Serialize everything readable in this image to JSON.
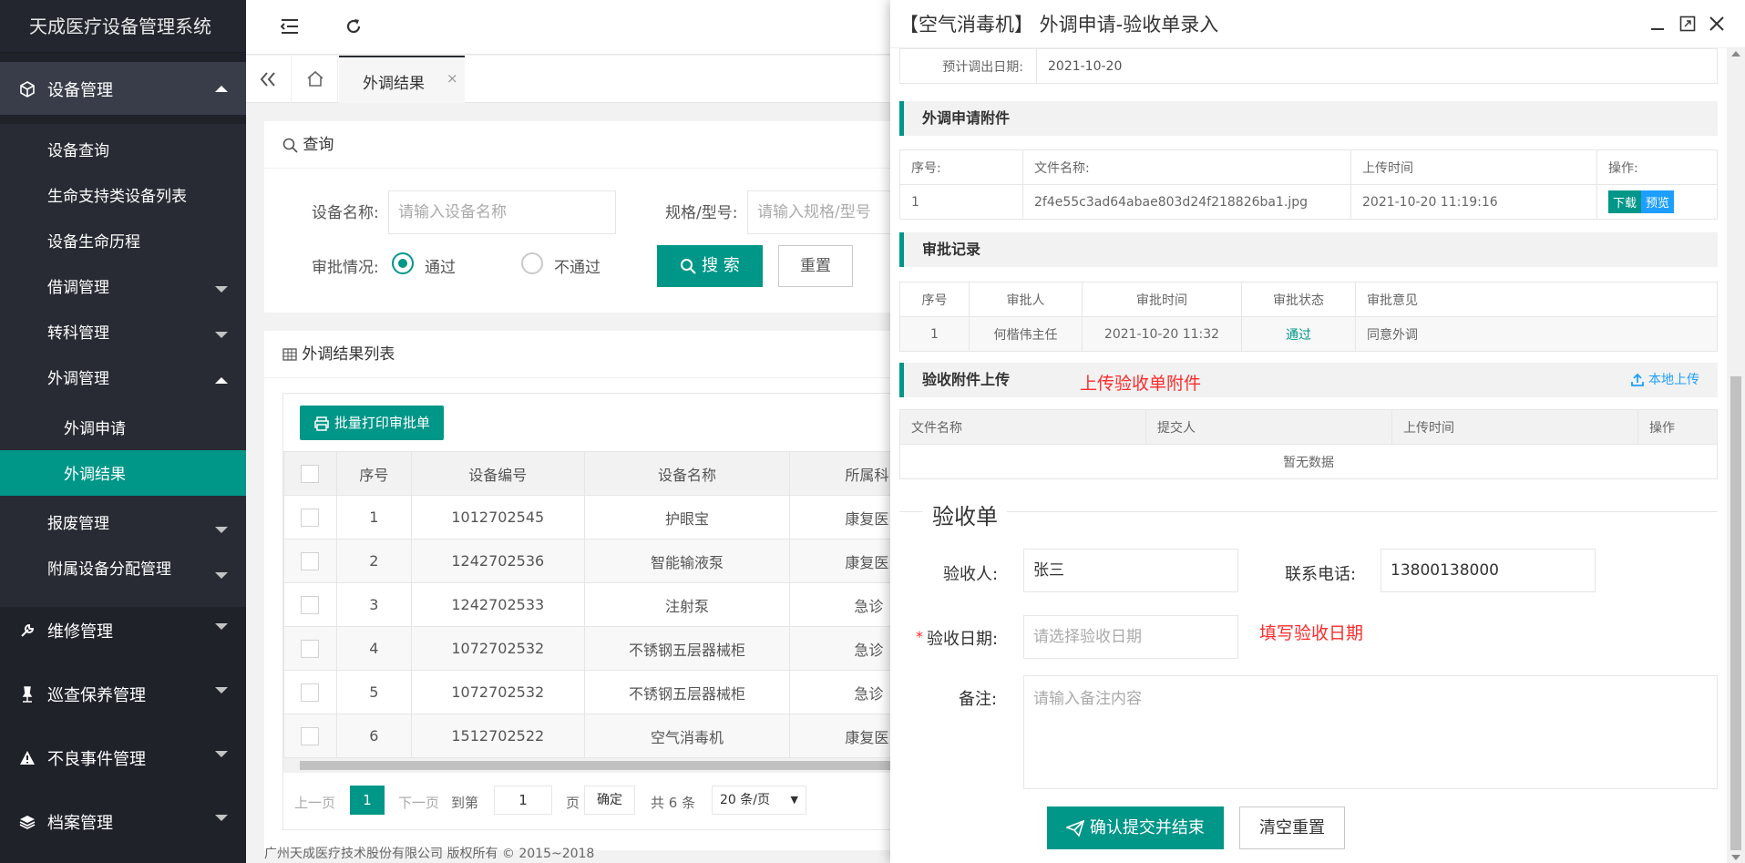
{
  "app": {
    "title": "天成医疗设备管理系统"
  },
  "sidebar": {
    "groups": {
      "device": {
        "label": "设备管理",
        "icon": "cube-icon"
      },
      "repair": {
        "label": "维修管理",
        "icon": "wrench-icon"
      },
      "inspect": {
        "label": "巡查保养管理",
        "icon": "pin-icon"
      },
      "adverse": {
        "label": "不良事件管理",
        "icon": "warning-icon"
      },
      "archive": {
        "label": "档案管理",
        "icon": "stack-icon"
      }
    },
    "device_items": {
      "query": "设备查询",
      "life_list": "生命支持类设备列表",
      "history": "设备生命历程",
      "borrow": "借调管理",
      "transfer": "转科管理",
      "external": "外调管理",
      "ext_apply": "外调申请",
      "ext_result": "外调结果",
      "scrap": "报废管理",
      "accessory": "附属设备分配管理"
    }
  },
  "tabs": {
    "current": "外调结果"
  },
  "query": {
    "title": "查询",
    "device_name_label": "设备名称:",
    "device_name_placeholder": "请输入设备名称",
    "spec_label": "规格/型号:",
    "spec_placeholder": "请输入规格/型号",
    "approval_label": "审批情况:",
    "pass": "通过",
    "fail": "不通过",
    "search": "搜 索",
    "reset": "重置"
  },
  "list": {
    "title": "外调结果列表",
    "batch_print": "批量打印审批单",
    "headers": {
      "no": "序号",
      "code": "设备编号",
      "name": "设备名称",
      "dept": "所属科"
    },
    "rows": [
      {
        "no": "1",
        "code": "1012702545",
        "name": "护眼宝",
        "dept": "康复医"
      },
      {
        "no": "2",
        "code": "1242702536",
        "name": "智能输液泵",
        "dept": "康复医"
      },
      {
        "no": "3",
        "code": "1242702533",
        "name": "注射泵",
        "dept": "急诊"
      },
      {
        "no": "4",
        "code": "1072702532",
        "name": "不锈钢五层器械柜",
        "dept": "急诊"
      },
      {
        "no": "5",
        "code": "1072702532",
        "name": "不锈钢五层器械柜",
        "dept": "急诊"
      },
      {
        "no": "6",
        "code": "1512702522",
        "name": "空气消毒机",
        "dept": "康复医"
      }
    ],
    "pager": {
      "prev": "上一页",
      "current": "1",
      "next": "下一页",
      "goto": "到第",
      "page_value": "1",
      "page_unit": "页",
      "confirm": "确定",
      "total": "共 6 条",
      "size": "20 条/页"
    }
  },
  "footer": {
    "copyright": "广州天成医疗技术股份有限公司 版权所有 © 2015~2018"
  },
  "modal": {
    "title": "【空气消毒机】 外调申请-验收单录入",
    "out_date_label": "预计调出日期:",
    "out_date": "2021-10-20",
    "attach": {
      "title": "外调申请附件",
      "headers": {
        "no": "序号:",
        "file": "文件名称:",
        "time": "上传时间",
        "op": "操作:"
      },
      "row": {
        "no": "1",
        "file": "2f4e55c3ad64abae803d24f218826ba1.jpg",
        "time": "2021-10-20 11:19:16"
      },
      "download": "下载",
      "preview": "预览"
    },
    "approval": {
      "title": "审批记录",
      "headers": {
        "no": "序号",
        "person": "审批人",
        "time": "审批时间",
        "status": "审批状态",
        "opinion": "审批意见"
      },
      "row": {
        "no": "1",
        "person": "何楷伟主任",
        "time": "2021-10-20 11:32",
        "status": "通过",
        "opinion": "同意外调"
      }
    },
    "upload": {
      "title": "验收附件上传",
      "hint": "上传验收单附件",
      "local": "本地上传",
      "headers": {
        "file": "文件名称",
        "submitter": "提交人",
        "time": "上传时间",
        "op": "操作"
      },
      "empty": "暂无数据"
    },
    "form": {
      "legend": "验收单",
      "person_label": "验收人:",
      "person_value": "张三",
      "phone_label": "联系电话:",
      "phone_value": "13800138000",
      "date_label": "验收日期:",
      "date_placeholder": "请选择验收日期",
      "date_hint": "填写验收日期",
      "remark_label": "备注:",
      "remark_placeholder": "请输入备注内容",
      "submit": "确认提交并结束",
      "clear": "清空重置"
    }
  },
  "colors": {
    "primary": "#009688",
    "sidebar": "#20222a",
    "blue": "#1e9fff",
    "red": "#ff2b2b",
    "pass": "#009688"
  }
}
